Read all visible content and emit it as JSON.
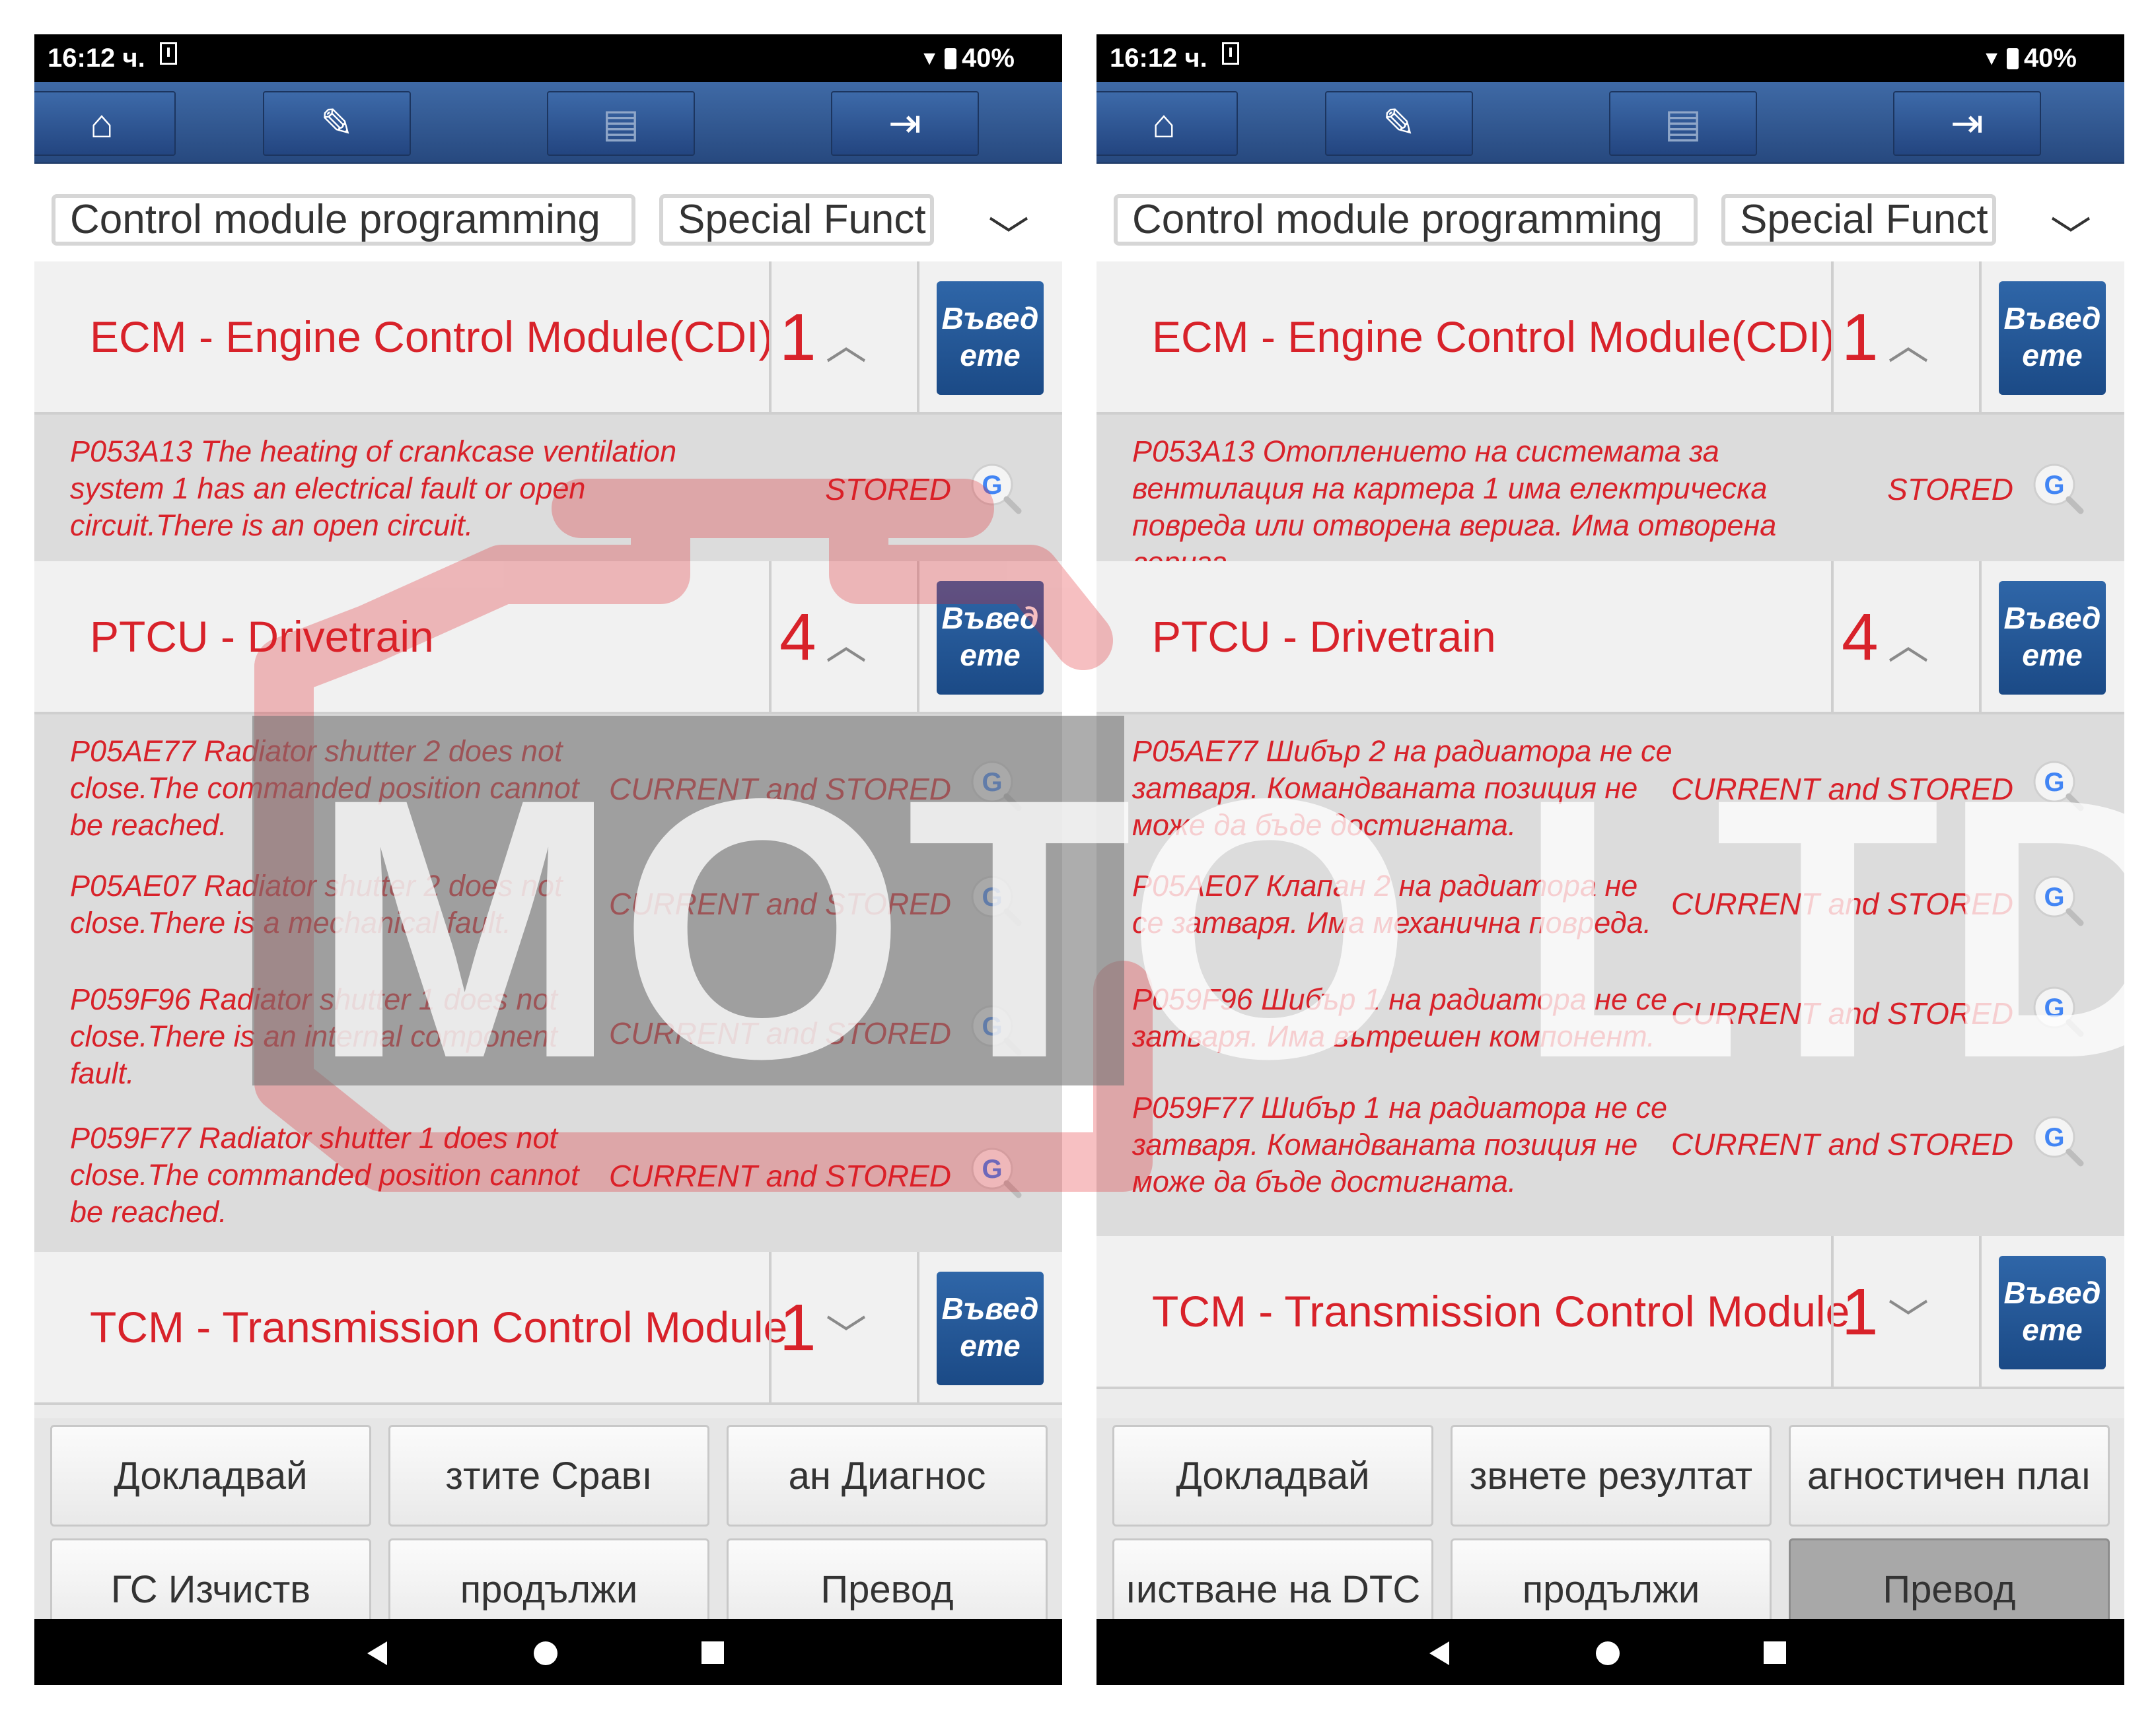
{
  "status_bar": {
    "time": "16:12 ч.",
    "battery": "40%"
  },
  "toolbar": {
    "icons": [
      "home-icon",
      "edit-icon",
      "print-icon",
      "exit-icon"
    ]
  },
  "breadcrumb": {
    "item1": "Control module programming",
    "item2": "Special Funct"
  },
  "left": {
    "modules": [
      {
        "name": "ECM - Engine Control Module(CDI)",
        "count": "1",
        "enter": "Въвед ете",
        "dtcs": [
          {
            "text": "P053A13 The heating of crankcase ventilation system 1 has an electrical fault or open circuit.There is an open circuit.",
            "status": "STORED"
          }
        ]
      },
      {
        "name": "PTCU - Drivetrain",
        "count": "4",
        "enter": "Въвед ете",
        "dtcs": [
          {
            "text": "P05AE77 Radiator shutter 2 does not close.The commanded position cannot be reached.",
            "status": "CURRENT and STORED"
          },
          {
            "text": "P05AE07 Radiator shutter 2 does not close.There is a mechanical fault.",
            "status": "CURRENT and STORED"
          },
          {
            "text": "P059F96 Radiator shutter 1 does not close.There is an internal component fault.",
            "status": "CURRENT and STORED"
          },
          {
            "text": "P059F77 Radiator shutter 1 does not close.The commanded position cannot be reached.",
            "status": "CURRENT and STORED"
          }
        ]
      },
      {
        "name": "TCM - Transmission Control Module",
        "count": "1",
        "enter": "Въвед ете"
      }
    ],
    "buttons": [
      "Докладвай",
      "зтите        Сравı",
      "ан        Диагнос",
      "ГС        Изчиств",
      "продължи",
      "Превод"
    ]
  },
  "right": {
    "modules": [
      {
        "name": "ECM - Engine Control Module(CDI)",
        "count": "1",
        "enter": "Въвед ете",
        "dtcs": [
          {
            "text": "P053A13 Отоплението на системата за вентилация на картера 1 има електрическа повреда или отворена верига. Има отворена верига.",
            "status": "STORED"
          }
        ]
      },
      {
        "name": "PTCU - Drivetrain",
        "count": "4",
        "enter": "Въвед ете",
        "dtcs": [
          {
            "text": "P05AE77 Шибър 2 на радиатора не се затваря. Командваната позиция не може да бъде достигната.",
            "status": "CURRENT and STORED"
          },
          {
            "text": "P05AE07 Клапан 2 на радиатора не се затваря. Има механична повреда.",
            "status": "CURRENT and STORED"
          },
          {
            "text": "P059F96 Шибър 1 на радиатора не се затваря. Има вътрешен компонент.",
            "status": "CURRENT and STORED"
          },
          {
            "text": "P059F77 Шибър 1 на радиатора не се затваря. Командваната позиция не може да бъде достигната.",
            "status": "CURRENT and STORED"
          }
        ]
      },
      {
        "name": "TCM - Transmission Control Module",
        "count": "1",
        "enter": "Въвед ете"
      }
    ],
    "buttons": [
      "Докладвай",
      "звнете резултат",
      "агностичен плаı",
      "ıистване на DTC",
      "продължи",
      "Превод"
    ]
  },
  "watermark": {
    "text": "MOTO LTD"
  },
  "colors": {
    "accent_red": "#d8222a",
    "toolbar_blue": "#2e5590",
    "enter_blue": "#1f5392"
  }
}
